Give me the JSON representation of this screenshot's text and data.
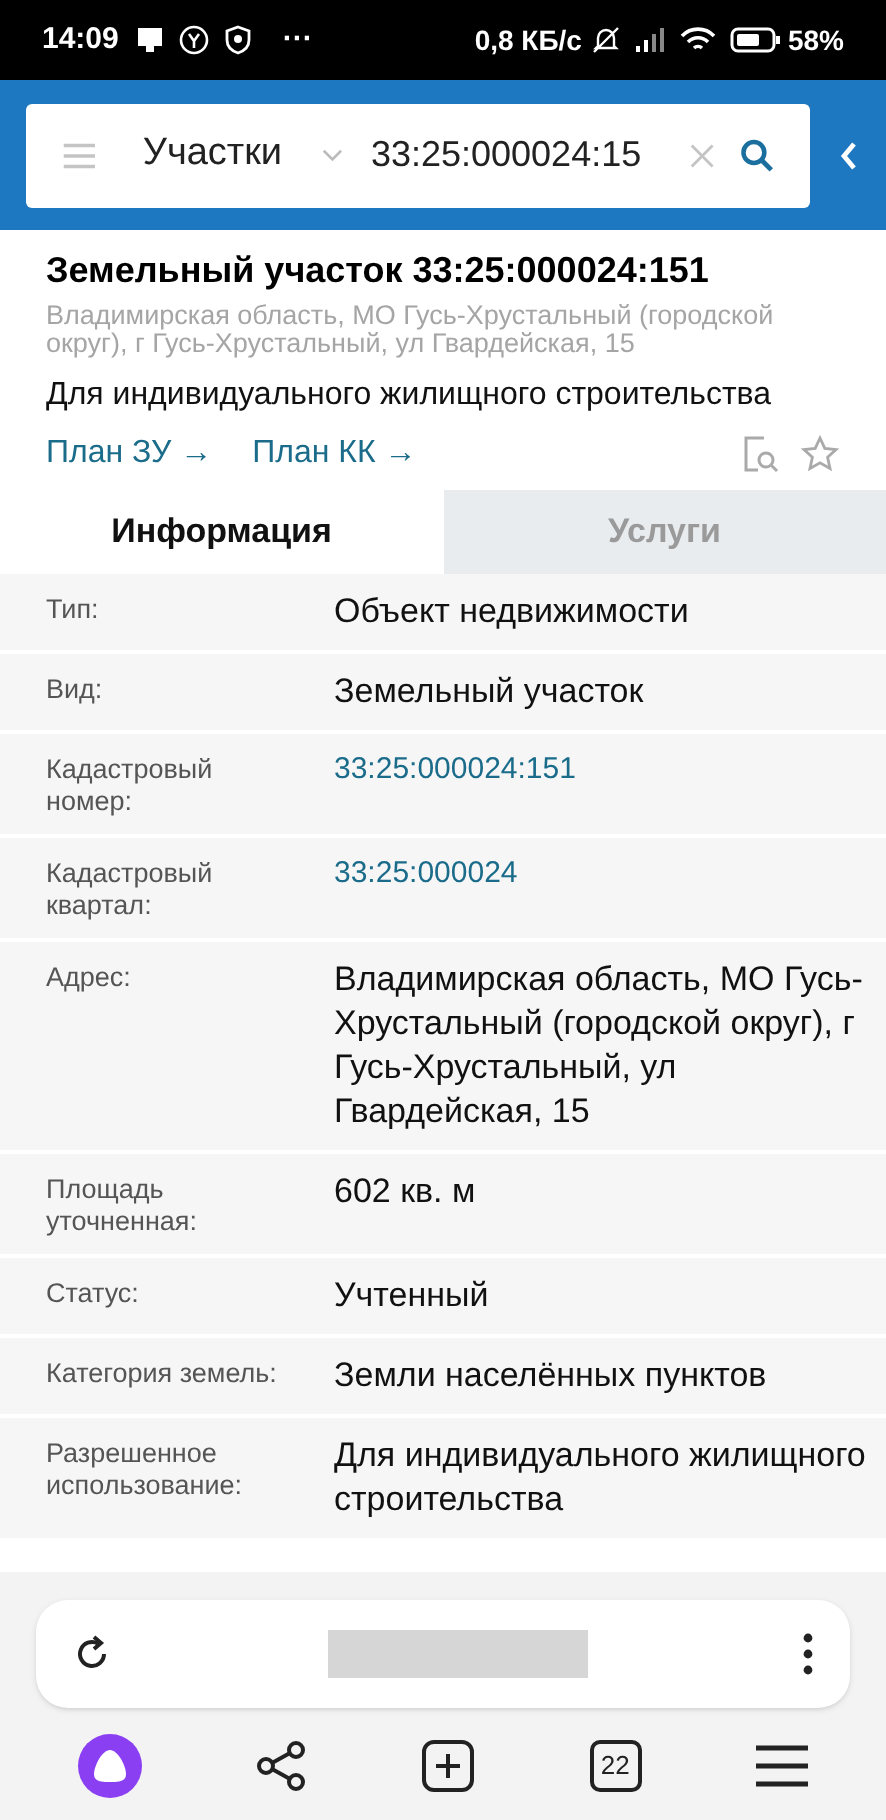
{
  "status_bar": {
    "time": "14:09",
    "more": "···",
    "speed": "0,8 КБ/с",
    "battery": "58%"
  },
  "search": {
    "category": "Участки",
    "value": "33:25:000024:15"
  },
  "parcel": {
    "title": "Земельный участок 33:25:000024:151",
    "address": "Владимирская область, МО Гусь-Хрустальный (городской округ), г Гусь-Хрустальный, ул Гвардейская, 15",
    "purpose": "Для индивидуального жилищного строительства",
    "links": [
      "План ЗУ →",
      "План КК →"
    ]
  },
  "tabs": [
    {
      "label": "Информация",
      "selected": true
    },
    {
      "label": "Услуги",
      "selected": false
    }
  ],
  "rows": [
    {
      "label": "Тип:",
      "value": "Объект недвижимости",
      "kind": "text"
    },
    {
      "label": "Вид:",
      "value": "Земельный участок",
      "kind": "text"
    },
    {
      "label": "Кадастровый номер:",
      "value": "33:25:000024:151",
      "kind": "link"
    },
    {
      "label": "Кадастровый квартал:",
      "value": "33:25:000024",
      "kind": "link"
    },
    {
      "label": "Адрес:",
      "value": "Владимирская область, МО Гусь-Хрустальный (городской округ), г Гусь-Хрустальный, ул Гвардейская, 15",
      "kind": "text"
    },
    {
      "label": "Площадь уточненная:",
      "value": "602 кв. м",
      "kind": "text"
    },
    {
      "label": "Статус:",
      "value": "Учтенный",
      "kind": "text"
    },
    {
      "label": "Категория земель:",
      "value": "Земли населённых пунктов",
      "kind": "text"
    },
    {
      "label": "Разрешенное использование:",
      "value": "Для индивидуального жилищного строительства",
      "kind": "text"
    }
  ],
  "browser": {
    "tab_count": "22"
  }
}
